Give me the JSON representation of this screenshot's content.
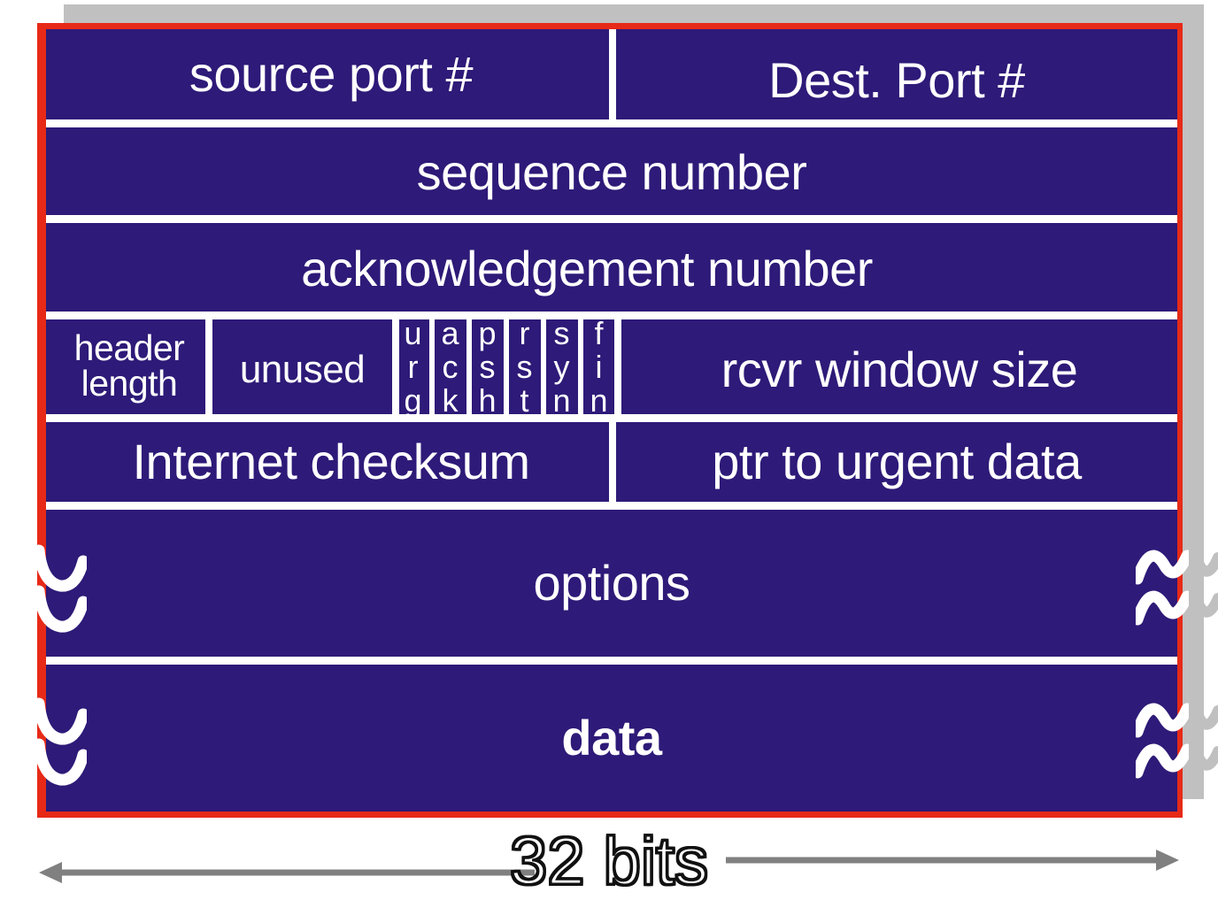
{
  "diagram": {
    "title": "TCP segment structure",
    "colors": {
      "field_background": "#2e1a78",
      "frame": "#e62a17",
      "shadow": "#c0c0c0",
      "text": "#ffffff",
      "separator": "#ffffff",
      "measure_text_outline": "#111111",
      "arrow": "#808080"
    },
    "rows": [
      {
        "name": "ports",
        "fields": [
          {
            "label": "source port #"
          },
          {
            "label": "Dest. Port  #"
          }
        ]
      },
      {
        "name": "sequence",
        "fields": [
          {
            "label": "sequence number"
          }
        ]
      },
      {
        "name": "acknowledgement",
        "fields": [
          {
            "label": "acknowledgement number"
          }
        ]
      },
      {
        "name": "flags-and-window",
        "fields": [
          {
            "label": "header length",
            "line1": "header",
            "line2": "length"
          },
          {
            "label": "unused"
          },
          {
            "label": "rcvr window size"
          }
        ],
        "flags": [
          {
            "name": "urg",
            "letters": [
              "u",
              "r",
              "g"
            ]
          },
          {
            "name": "ack",
            "letters": [
              "a",
              "c",
              "k"
            ]
          },
          {
            "name": "psh",
            "letters": [
              "p",
              "s",
              "h"
            ]
          },
          {
            "name": "rst",
            "letters": [
              "r",
              "s",
              "t"
            ]
          },
          {
            "name": "syn",
            "letters": [
              "s",
              "y",
              "n"
            ]
          },
          {
            "name": "fin",
            "letters": [
              "f",
              "i",
              "n"
            ]
          }
        ]
      },
      {
        "name": "checksum-and-urgent",
        "fields": [
          {
            "label": "Internet checksum"
          },
          {
            "label": "ptr to urgent data"
          }
        ]
      },
      {
        "name": "options",
        "fields": [
          {
            "label": "options"
          }
        ],
        "continuation_marks": true
      },
      {
        "name": "data",
        "fields": [
          {
            "label": "data"
          }
        ],
        "continuation_marks": true,
        "bold": true
      }
    ]
  },
  "measure": {
    "label": "32 bits",
    "icon_left": "arrow-left-icon",
    "icon_right": "arrow-right-icon"
  }
}
